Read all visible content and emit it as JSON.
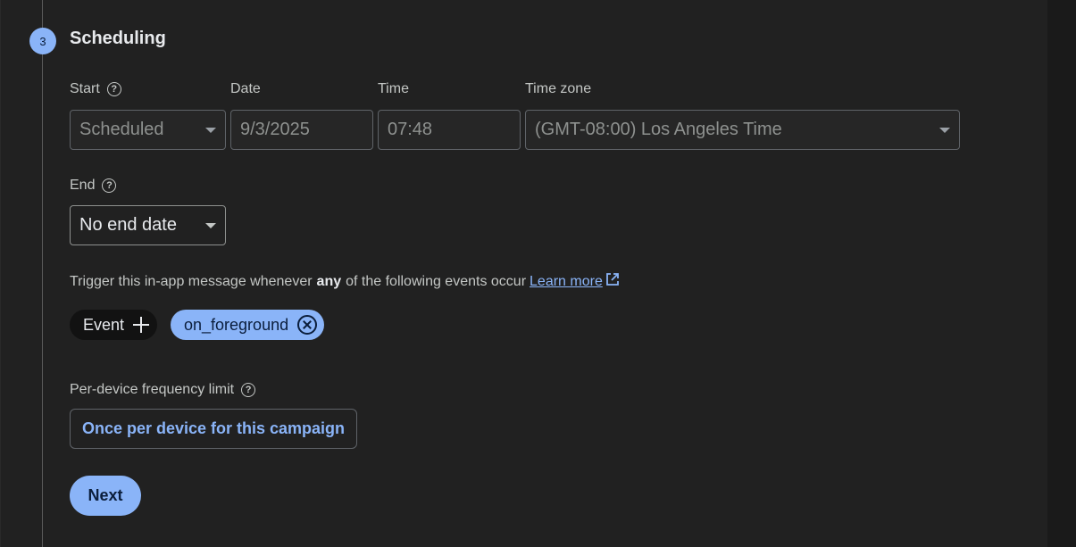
{
  "step": {
    "number": "3",
    "title": "Scheduling"
  },
  "start": {
    "start_label": "Start",
    "date_label": "Date",
    "time_label": "Time",
    "timezone_label": "Time zone",
    "mode_value": "Scheduled",
    "date_value": "9/3/2025",
    "time_value": "07:48",
    "timezone_value": "(GMT-08:00) Los Angeles Time"
  },
  "end": {
    "label": "End",
    "value": "No end date"
  },
  "trigger": {
    "text_before": "Trigger this in-app message whenever",
    "emphasis": "any",
    "text_after": "of the following events occur",
    "learn_more": "Learn more",
    "event_chip_label": "Event",
    "events": [
      "on_foreground"
    ]
  },
  "frequency": {
    "label": "Per-device frequency limit",
    "value": "Once per device for this campaign"
  },
  "actions": {
    "next_label": "Next"
  },
  "colors": {
    "accent": "#8ab4f8",
    "background": "#212121",
    "chip_dark": "#121212"
  }
}
